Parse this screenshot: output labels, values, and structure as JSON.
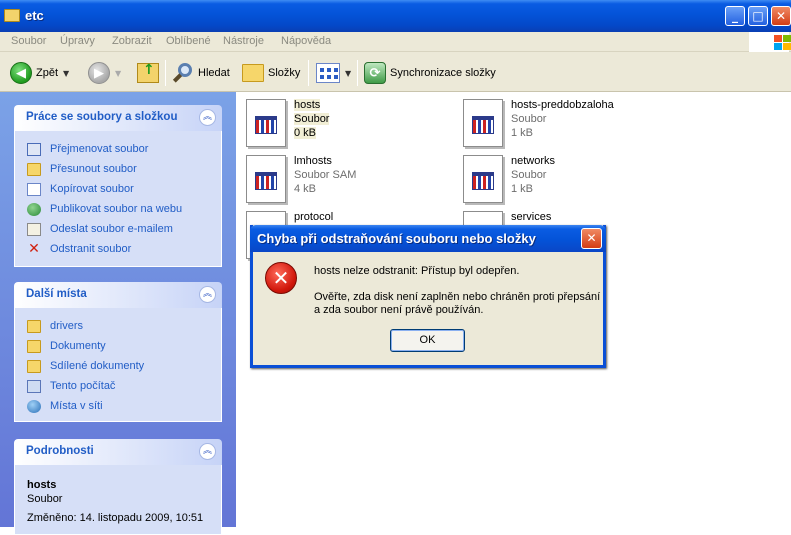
{
  "window": {
    "title": "etc",
    "minimize_glyph": "_",
    "maximize_glyph": "□",
    "close_glyph": "✕"
  },
  "menubar": {
    "items": [
      "Soubor",
      "Úpravy",
      "Zobrazit",
      "Oblíbené",
      "Nástroje",
      "Nápověda"
    ]
  },
  "toolbar": {
    "back_label": "Zpět",
    "search_label": "Hledat",
    "folders_label": "Složky",
    "sync_label": "Synchronizace složky"
  },
  "leftpane": {
    "tasks": {
      "title": "Práce se soubory a složkou",
      "links": [
        {
          "label": "Přejmenovat soubor",
          "icon": "rename-icon"
        },
        {
          "label": "Přesunout soubor",
          "icon": "move-icon"
        },
        {
          "label": "Kopírovat soubor",
          "icon": "copy-icon"
        },
        {
          "label": "Publikovat soubor na webu",
          "icon": "globe-icon"
        },
        {
          "label": "Odeslat soubor e-mailem",
          "icon": "mail-icon"
        },
        {
          "label": "Odstranit soubor",
          "icon": "delete-icon"
        }
      ]
    },
    "places": {
      "title": "Další místa",
      "links": [
        {
          "label": "drivers",
          "icon": "folder-icon"
        },
        {
          "label": "Dokumenty",
          "icon": "folder-icon"
        },
        {
          "label": "Sdílené dokumenty",
          "icon": "folder-icon"
        },
        {
          "label": "Tento počítač",
          "icon": "computer-icon"
        },
        {
          "label": "Místa v síti",
          "icon": "network-icon"
        }
      ]
    },
    "details": {
      "title": "Podrobnosti",
      "name": "hosts",
      "type": "Soubor",
      "modified": "Změněno: 14. listopadu 2009, 10:51"
    }
  },
  "files": [
    {
      "name": "hosts",
      "type": "Soubor",
      "size": "0 kB"
    },
    {
      "name": "hosts-preddobzaloha",
      "type": "Soubor",
      "size": "1 kB"
    },
    {
      "name": "lmhosts",
      "type": "Soubor SAM",
      "size": "4 kB"
    },
    {
      "name": "networks",
      "type": "Soubor",
      "size": "1 kB"
    },
    {
      "name": "protocol",
      "type": "",
      "size": ""
    },
    {
      "name": "services",
      "type": "",
      "size": ""
    }
  ],
  "dialog": {
    "title": "Chyba při odstraňování souboru nebo složky",
    "message1": "hosts nelze odstranit: Přístup byl odepřen.",
    "message2": "Ověřte, zda disk není zaplněn nebo chráněn proti přepsání",
    "message3": "a zda soubor není právě používán.",
    "ok_label": "OK",
    "icon": "error-icon",
    "close_glyph": "✕"
  },
  "colors": {
    "titlebar_blue": "#0453d8",
    "panel_link": "#215dc6",
    "leftpane_bg": "#6f8fdf",
    "close_red": "#d43d14"
  }
}
